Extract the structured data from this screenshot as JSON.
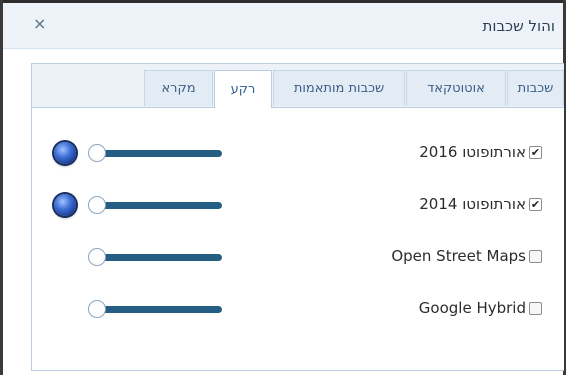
{
  "dialog": {
    "title": "והול שכבות",
    "close_glyph": "×"
  },
  "tabs": [
    {
      "label": "שכבות",
      "active": false
    },
    {
      "label": "אוטוטקאד",
      "active": false
    },
    {
      "label": "שכבות מותאמות",
      "active": false
    },
    {
      "label": "רקע",
      "active": true
    },
    {
      "label": "מקרא",
      "active": false
    }
  ],
  "layers": [
    {
      "label": "אורתופוטו 2016",
      "checked": true,
      "check_glyph": "✔",
      "visible_indicator": true
    },
    {
      "label": "אורתופוטו 2014",
      "checked": true,
      "check_glyph": "✔",
      "visible_indicator": true
    },
    {
      "label": "Open Street Maps",
      "checked": false,
      "check_glyph": "",
      "visible_indicator": false
    },
    {
      "label": "Google Hybrid",
      "checked": false,
      "check_glyph": "",
      "visible_indicator": false
    }
  ],
  "colors": {
    "accent": "#2f5f93",
    "slider": "#245f83",
    "indicator": "#3f6fd6"
  }
}
